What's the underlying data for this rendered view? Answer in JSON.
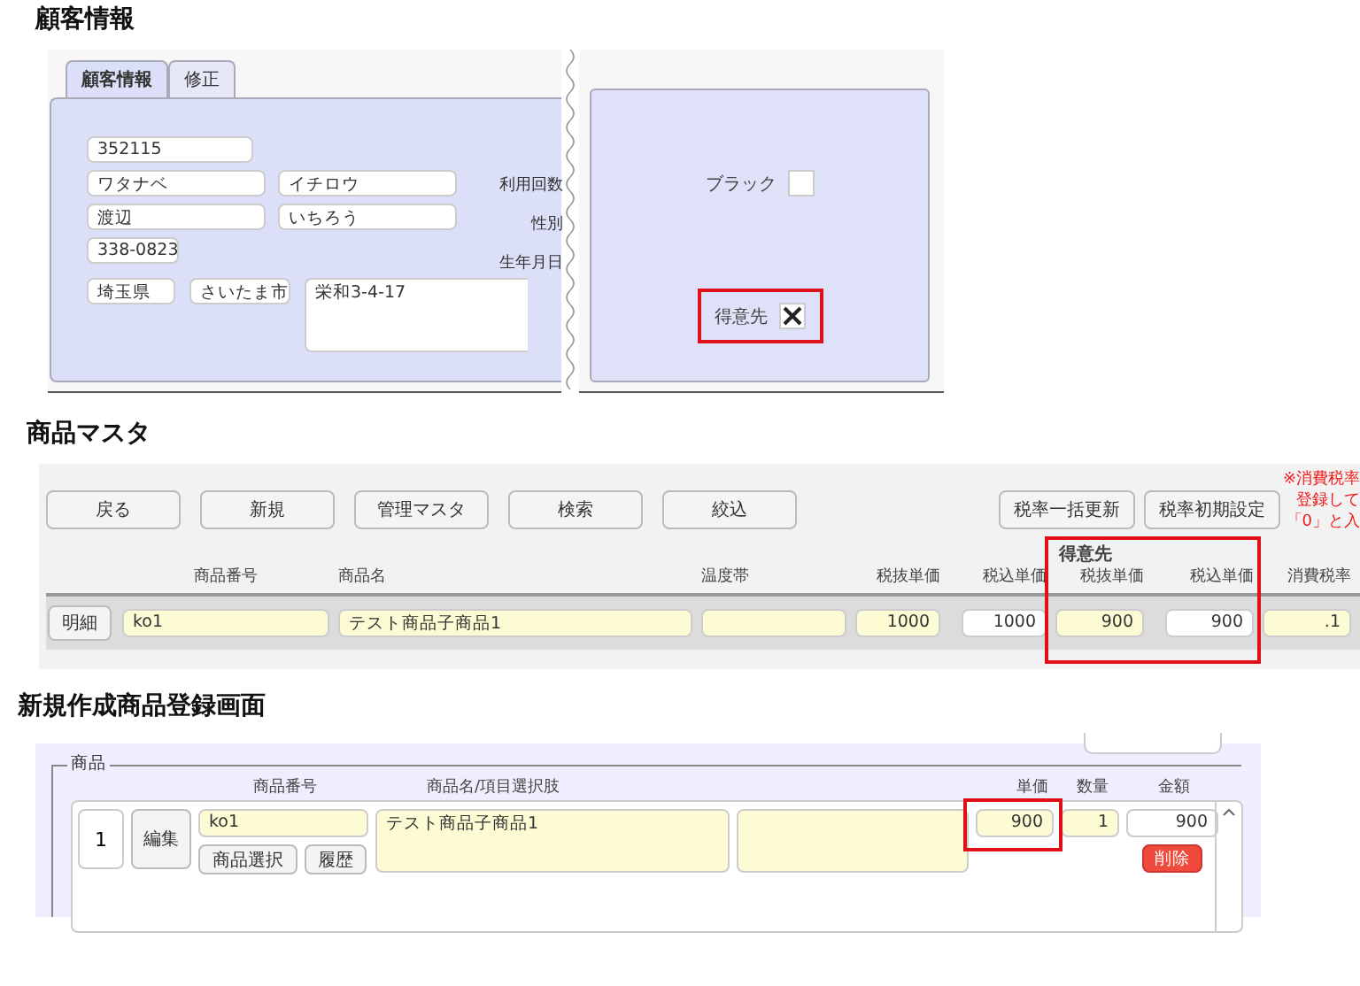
{
  "customer_section": {
    "heading": "顧客情報",
    "tabs": [
      {
        "label": "顧客情報",
        "selected": true
      },
      {
        "label": "修正",
        "selected": false
      }
    ],
    "field_rows": [
      [
        "352115"
      ],
      [
        "ワタナベ",
        "イチロウ"
      ],
      [
        "渡辺",
        "いちろう"
      ],
      [
        "338-0823"
      ]
    ],
    "side_labels": [
      "利用回数",
      "性別",
      "生年月日"
    ],
    "address": {
      "prefecture": "埼玉県",
      "city": "さいたま市",
      "street": "栄和3-4-17"
    },
    "flags": [
      {
        "label": "ブラック",
        "checked": false,
        "highlighted": false
      },
      {
        "label": "得意先",
        "checked": true,
        "highlighted": true
      }
    ]
  },
  "product_master": {
    "heading": "商品マスタ",
    "buttons_left": [
      "戻る",
      "新規",
      "管理マスタ",
      "検索",
      "絞込"
    ],
    "buttons_right": [
      "税率一括更新",
      "税率初期設定"
    ],
    "notes": [
      "※消費税率",
      "登録して",
      "「0」と入"
    ],
    "group_header": {
      "label": "得意先",
      "highlighted": true
    },
    "columns": [
      "商品番号",
      "商品名",
      "温度帯",
      "税抜単価",
      "税込単価",
      "税抜単価",
      "税込単価",
      "消費税率"
    ],
    "row": {
      "detail_button": "明細",
      "cells": [
        {
          "value": "ko1",
          "color": "#fdfbd3"
        },
        {
          "value": "テスト商品子商品1",
          "color": "#fdfbd3"
        },
        {
          "color": "#fdfbd3"
        },
        {
          "value": "1000",
          "color": "#fdfbd3"
        },
        {
          "value": "1000",
          "color": "#ffffff"
        },
        {
          "value": "900",
          "color": "#fdfbd3"
        },
        {
          "value": "900",
          "color": "#ffffff"
        },
        {
          "value": ".1",
          "color": "#fdfbd3"
        }
      ]
    }
  },
  "new_product_screen": {
    "heading": "新規作成商品登録画面",
    "legend": "商品",
    "columns": [
      "商品番号",
      "商品名/項目選択肢",
      "単価",
      "数量",
      "金額"
    ],
    "row": {
      "number": "1",
      "edit_button": "編集",
      "code": "ko1",
      "select_button": "商品選択",
      "history_button": "履歴",
      "name": "テスト商品子商品1",
      "price": {
        "value": "900",
        "highlighted": true
      },
      "quantity": "1",
      "amount": "900",
      "delete_button": "削除"
    }
  }
}
